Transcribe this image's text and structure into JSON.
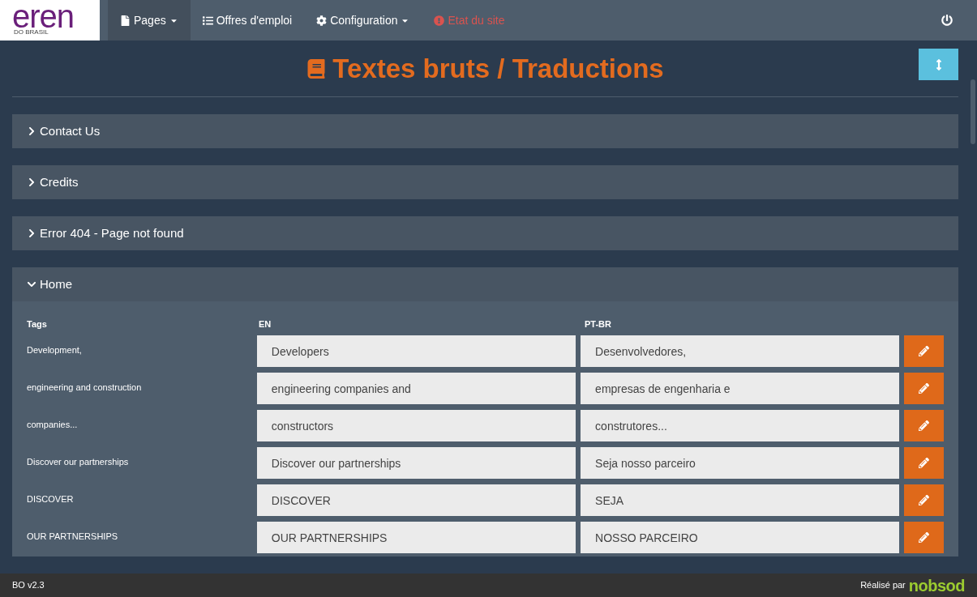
{
  "logo": {
    "wordmark": "eren",
    "subtitle": "DO BRASIL"
  },
  "nav": [
    {
      "label": "Pages",
      "kind": "file",
      "dropdown": true,
      "selected": true,
      "alert": false
    },
    {
      "label": "Offres d'emploi",
      "kind": "list",
      "dropdown": false,
      "selected": false,
      "alert": false
    },
    {
      "label": "Configuration",
      "kind": "gear",
      "dropdown": true,
      "selected": false,
      "alert": false
    },
    {
      "label": "Etat du site",
      "kind": "alert",
      "dropdown": false,
      "selected": false,
      "alert": true
    }
  ],
  "title": "Textes bruts / Traductions",
  "sections": [
    {
      "label": "Contact Us",
      "expanded": false
    },
    {
      "label": "Credits",
      "expanded": false
    },
    {
      "label": "Error 404 - Page not found",
      "expanded": false
    },
    {
      "label": "Home",
      "expanded": true
    }
  ],
  "table": {
    "columns": [
      "Tags",
      "EN",
      "PT-BR"
    ],
    "rows": [
      {
        "tag": "Development,",
        "en": "Developers",
        "pt": "Desenvolvedores,"
      },
      {
        "tag": "engineering and construction",
        "en": "engineering companies and",
        "pt": "empresas de engenharia e"
      },
      {
        "tag": "companies...",
        "en": "constructors",
        "pt": "construtores..."
      },
      {
        "tag": "Discover our partnerships",
        "en": "Discover our partnerships",
        "pt": "Seja nosso parceiro"
      },
      {
        "tag": "DISCOVER",
        "en": "DISCOVER",
        "pt": "SEJA"
      },
      {
        "tag": "OUR PARTNERSHIPS",
        "en": "OUR PARTNERSHIPS",
        "pt": "NOSSO PARCEIRO"
      }
    ]
  },
  "footer": {
    "version": "BO v2.3",
    "credit": "Réalisé par",
    "brand": "nobsod"
  }
}
